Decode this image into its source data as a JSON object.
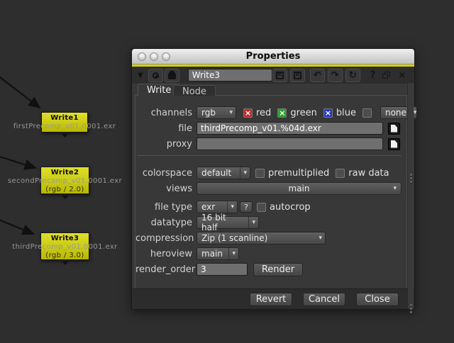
{
  "window": {
    "title": "Properties"
  },
  "toolbar": {
    "node_name": "Write3"
  },
  "icons": {
    "collapse_triangle": "▼",
    "dropdown_arrow": "▾",
    "check_x": "×",
    "box_x": "×",
    "undo": "↶",
    "redo": "↷",
    "recycle": "↻",
    "help": "?",
    "close": "×"
  },
  "tabs": {
    "write": "Write",
    "node": "Node"
  },
  "form": {
    "channels": {
      "label": "channels",
      "value": "rgb",
      "boxes": [
        {
          "label": "red"
        },
        {
          "label": "green"
        },
        {
          "label": "blue"
        }
      ],
      "extra_value": "none"
    },
    "file": {
      "label": "file",
      "value": "thirdPrecomp_v01.%04d.exr"
    },
    "proxy": {
      "label": "proxy",
      "value": ""
    },
    "colorspace": {
      "label": "colorspace",
      "value": "default",
      "premult_label": "premultiplied",
      "raw_label": "raw data"
    },
    "views": {
      "label": "views",
      "value": "main"
    },
    "file_type": {
      "label": "file type",
      "value": "exr",
      "help": "?",
      "autocrop_label": "autocrop"
    },
    "datatype": {
      "label": "datatype",
      "value": "16 bit half"
    },
    "compression": {
      "label": "compression",
      "value": "Zip (1 scanline)"
    },
    "heroview": {
      "label": "heroview",
      "value": "main"
    },
    "render_order": {
      "label": "render_order",
      "value": "3",
      "button": "Render"
    }
  },
  "footer": {
    "revert": "Revert",
    "cancel": "Cancel",
    "close": "Close"
  },
  "node_graph": {
    "nodes": [
      {
        "name": "Write1",
        "file": "firstPrecomp_v01.0001.exr",
        "info": ""
      },
      {
        "name": "Write2",
        "file": "secondPrecomp_v01.0001.exr",
        "info": "(rgb / 2.0)"
      },
      {
        "name": "Write3",
        "file": "thirdPrecomp_v01.0001.exr",
        "info": "(rgb / 3.0)"
      }
    ]
  },
  "colors": {
    "accent": "#d4d400",
    "node_yellow": "#d2d21a",
    "red": "#c12b2b",
    "green": "#2ea22e",
    "blue": "#2b39c1"
  }
}
